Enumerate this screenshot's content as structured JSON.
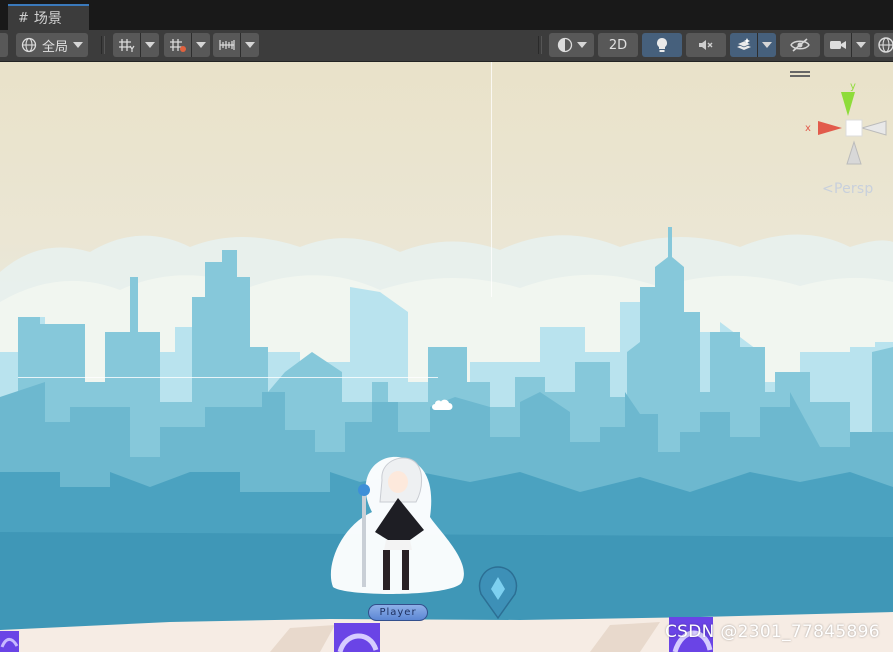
{
  "window": {
    "tab_label": "场景"
  },
  "toolbar": {
    "global_label": "全局",
    "mode_2d_label": "2D"
  },
  "scene": {
    "projection_label": "Persp",
    "gizmo_axis_y": "y",
    "gizmo_axis_x": "x",
    "player_label": "Player"
  },
  "watermark": "CSDN @2301_77845896",
  "colors": {
    "active_button": "#46607c",
    "accent_tab": "#3a79bb",
    "gizmo_x": "#e25b4b",
    "gizmo_y": "#8edc3a"
  },
  "icons": [
    "grid-icon",
    "globe-icon",
    "grid-snap-icon",
    "grid-increment-icon",
    "ruler-icon",
    "shading-icon",
    "lighting-icon",
    "audio-mute-icon",
    "effects-icon",
    "visibility-icon",
    "camera-icon",
    "gizmos-icon",
    "cloud-icon"
  ]
}
